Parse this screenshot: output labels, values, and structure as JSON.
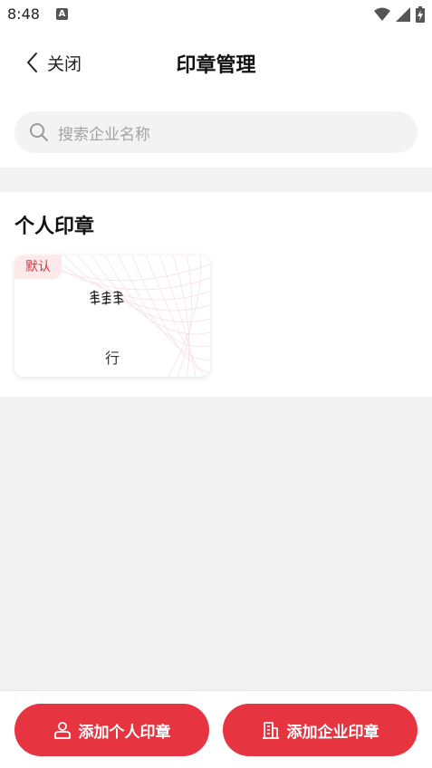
{
  "status_bar": {
    "time": "8:48",
    "notification_badge": "A"
  },
  "header": {
    "back_label": "关闭",
    "title": "印章管理"
  },
  "search": {
    "placeholder": "搜索企业名称"
  },
  "personal_section": {
    "title": "个人印章",
    "seals": [
      {
        "badge": "默认",
        "name": "行"
      }
    ]
  },
  "actions": {
    "add_personal": "添加个人印章",
    "add_enterprise": "添加企业印章"
  },
  "colors": {
    "accent": "#e63441",
    "badge_bg": "#fde8ea",
    "badge_text": "#d9363e",
    "page_bg": "#f3f3f3"
  }
}
